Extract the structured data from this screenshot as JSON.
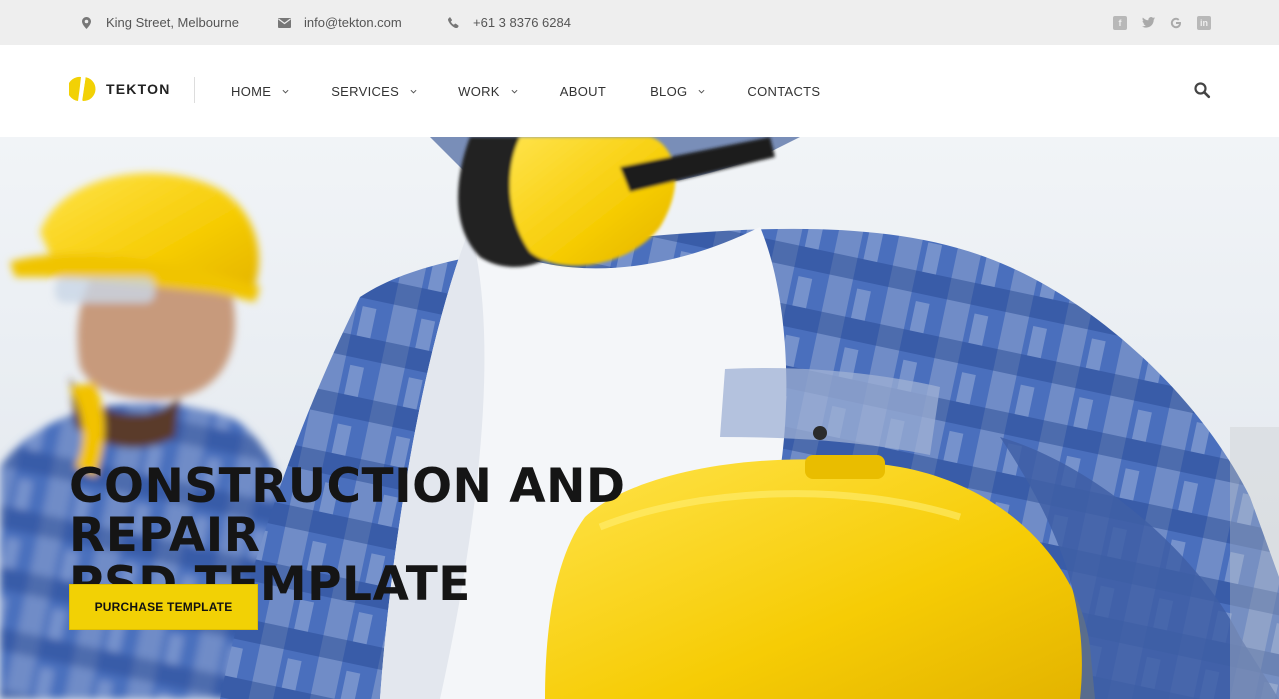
{
  "topbar": {
    "address": "King Street, Melbourne",
    "email": "info@tekton.com",
    "phone": "+61 3 8376 6284",
    "icons": {
      "address": "map-pin-icon",
      "email": "envelope-icon",
      "phone": "phone-icon"
    },
    "social": [
      "facebook-icon",
      "twitter-icon",
      "google-icon",
      "linkedin-icon"
    ]
  },
  "brand": {
    "name": "TEKTON",
    "color": "#f2d105"
  },
  "nav": {
    "home": "HOME",
    "services": "SERVICES",
    "work": "WORK",
    "about": "ABOUT",
    "blog": "BLOG",
    "contacts": "CONTACTS"
  },
  "hero": {
    "title_line1": "CONSTRUCTION AND REPAIR",
    "title_line2": "PSD TEMPLATE",
    "cta": "PURCHASE TEMPLATE"
  },
  "colors": {
    "accent": "#f2d105",
    "topbar_bg": "#eeeeee",
    "text_dark": "#151515"
  }
}
